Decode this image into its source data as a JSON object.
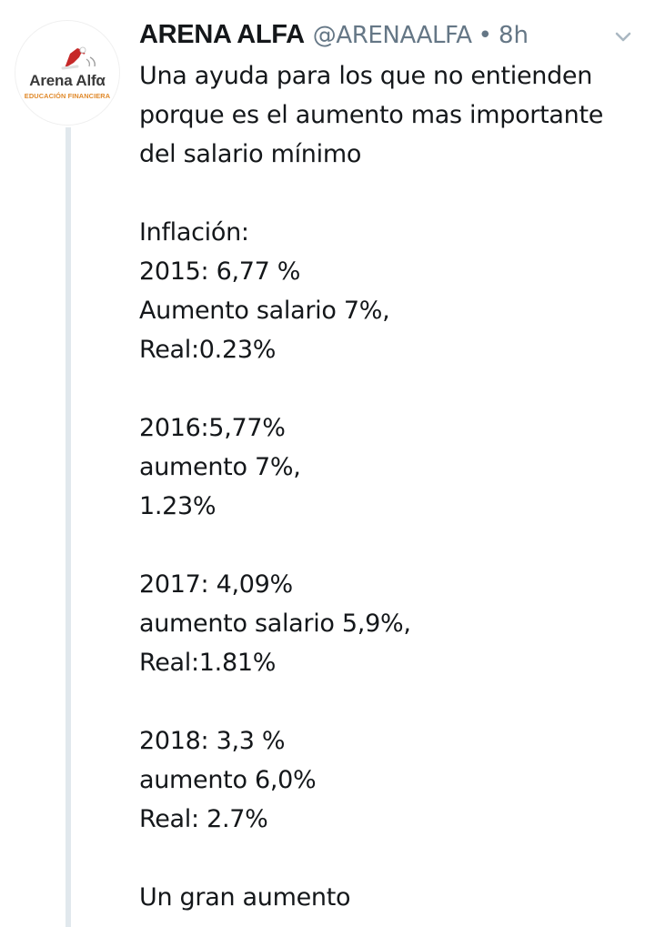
{
  "tweet": {
    "avatar": {
      "logo_name": "Arena Alfα",
      "logo_sub": "EDUCACIÓN FINANCIERA",
      "accent_color": "#e0892a"
    },
    "display_name": "ARENA ALFA",
    "handle": "@ARENAALFA",
    "separator": "•",
    "time": "8h",
    "caret_icon": "chevron-down-icon",
    "lines": [
      "Una ayuda para los que no entienden",
      "porque es el aumento mas importante",
      "del salario mínimo",
      "",
      "Inflación:",
      "2015: 6,77 %",
      "Aumento salario 7%,",
      "Real:0.23%",
      "",
      "2016:5,77%",
      "aumento 7%,",
      "1.23%",
      "",
      "2017: 4,09%",
      "aumento salario 5,9%,",
      "Real:1.81%",
      "",
      "2018: 3,3 %",
      "aumento 6,0%",
      "Real: 2.7%",
      "",
      "Un gran aumento"
    ]
  }
}
